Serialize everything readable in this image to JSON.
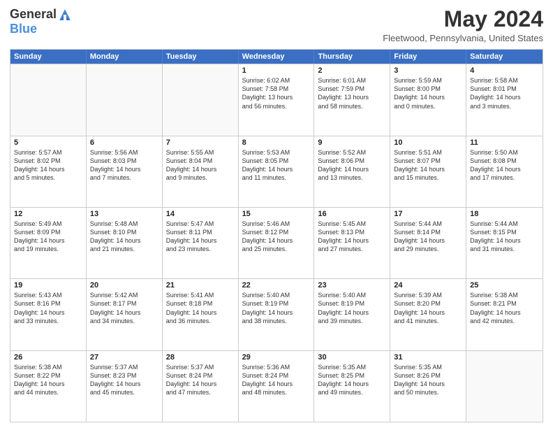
{
  "header": {
    "logo_general": "General",
    "logo_blue": "Blue",
    "month_title": "May 2024",
    "location": "Fleetwood, Pennsylvania, United States"
  },
  "calendar": {
    "days_of_week": [
      "Sunday",
      "Monday",
      "Tuesday",
      "Wednesday",
      "Thursday",
      "Friday",
      "Saturday"
    ],
    "rows": [
      [
        {
          "day": "",
          "empty": true
        },
        {
          "day": "",
          "empty": true
        },
        {
          "day": "",
          "empty": true
        },
        {
          "day": "1",
          "lines": [
            "Sunrise: 6:02 AM",
            "Sunset: 7:58 PM",
            "Daylight: 13 hours",
            "and 56 minutes."
          ]
        },
        {
          "day": "2",
          "lines": [
            "Sunrise: 6:01 AM",
            "Sunset: 7:59 PM",
            "Daylight: 13 hours",
            "and 58 minutes."
          ]
        },
        {
          "day": "3",
          "lines": [
            "Sunrise: 5:59 AM",
            "Sunset: 8:00 PM",
            "Daylight: 14 hours",
            "and 0 minutes."
          ]
        },
        {
          "day": "4",
          "lines": [
            "Sunrise: 5:58 AM",
            "Sunset: 8:01 PM",
            "Daylight: 14 hours",
            "and 3 minutes."
          ]
        }
      ],
      [
        {
          "day": "5",
          "lines": [
            "Sunrise: 5:57 AM",
            "Sunset: 8:02 PM",
            "Daylight: 14 hours",
            "and 5 minutes."
          ]
        },
        {
          "day": "6",
          "lines": [
            "Sunrise: 5:56 AM",
            "Sunset: 8:03 PM",
            "Daylight: 14 hours",
            "and 7 minutes."
          ]
        },
        {
          "day": "7",
          "lines": [
            "Sunrise: 5:55 AM",
            "Sunset: 8:04 PM",
            "Daylight: 14 hours",
            "and 9 minutes."
          ]
        },
        {
          "day": "8",
          "lines": [
            "Sunrise: 5:53 AM",
            "Sunset: 8:05 PM",
            "Daylight: 14 hours",
            "and 11 minutes."
          ]
        },
        {
          "day": "9",
          "lines": [
            "Sunrise: 5:52 AM",
            "Sunset: 8:06 PM",
            "Daylight: 14 hours",
            "and 13 minutes."
          ]
        },
        {
          "day": "10",
          "lines": [
            "Sunrise: 5:51 AM",
            "Sunset: 8:07 PM",
            "Daylight: 14 hours",
            "and 15 minutes."
          ]
        },
        {
          "day": "11",
          "lines": [
            "Sunrise: 5:50 AM",
            "Sunset: 8:08 PM",
            "Daylight: 14 hours",
            "and 17 minutes."
          ]
        }
      ],
      [
        {
          "day": "12",
          "lines": [
            "Sunrise: 5:49 AM",
            "Sunset: 8:09 PM",
            "Daylight: 14 hours",
            "and 19 minutes."
          ]
        },
        {
          "day": "13",
          "lines": [
            "Sunrise: 5:48 AM",
            "Sunset: 8:10 PM",
            "Daylight: 14 hours",
            "and 21 minutes."
          ]
        },
        {
          "day": "14",
          "lines": [
            "Sunrise: 5:47 AM",
            "Sunset: 8:11 PM",
            "Daylight: 14 hours",
            "and 23 minutes."
          ]
        },
        {
          "day": "15",
          "lines": [
            "Sunrise: 5:46 AM",
            "Sunset: 8:12 PM",
            "Daylight: 14 hours",
            "and 25 minutes."
          ]
        },
        {
          "day": "16",
          "lines": [
            "Sunrise: 5:45 AM",
            "Sunset: 8:13 PM",
            "Daylight: 14 hours",
            "and 27 minutes."
          ]
        },
        {
          "day": "17",
          "lines": [
            "Sunrise: 5:44 AM",
            "Sunset: 8:14 PM",
            "Daylight: 14 hours",
            "and 29 minutes."
          ]
        },
        {
          "day": "18",
          "lines": [
            "Sunrise: 5:44 AM",
            "Sunset: 8:15 PM",
            "Daylight: 14 hours",
            "and 31 minutes."
          ]
        }
      ],
      [
        {
          "day": "19",
          "lines": [
            "Sunrise: 5:43 AM",
            "Sunset: 8:16 PM",
            "Daylight: 14 hours",
            "and 33 minutes."
          ]
        },
        {
          "day": "20",
          "lines": [
            "Sunrise: 5:42 AM",
            "Sunset: 8:17 PM",
            "Daylight: 14 hours",
            "and 34 minutes."
          ]
        },
        {
          "day": "21",
          "lines": [
            "Sunrise: 5:41 AM",
            "Sunset: 8:18 PM",
            "Daylight: 14 hours",
            "and 36 minutes."
          ]
        },
        {
          "day": "22",
          "lines": [
            "Sunrise: 5:40 AM",
            "Sunset: 8:19 PM",
            "Daylight: 14 hours",
            "and 38 minutes."
          ]
        },
        {
          "day": "23",
          "lines": [
            "Sunrise: 5:40 AM",
            "Sunset: 8:19 PM",
            "Daylight: 14 hours",
            "and 39 minutes."
          ]
        },
        {
          "day": "24",
          "lines": [
            "Sunrise: 5:39 AM",
            "Sunset: 8:20 PM",
            "Daylight: 14 hours",
            "and 41 minutes."
          ]
        },
        {
          "day": "25",
          "lines": [
            "Sunrise: 5:38 AM",
            "Sunset: 8:21 PM",
            "Daylight: 14 hours",
            "and 42 minutes."
          ]
        }
      ],
      [
        {
          "day": "26",
          "lines": [
            "Sunrise: 5:38 AM",
            "Sunset: 8:22 PM",
            "Daylight: 14 hours",
            "and 44 minutes."
          ]
        },
        {
          "day": "27",
          "lines": [
            "Sunrise: 5:37 AM",
            "Sunset: 8:23 PM",
            "Daylight: 14 hours",
            "and 45 minutes."
          ]
        },
        {
          "day": "28",
          "lines": [
            "Sunrise: 5:37 AM",
            "Sunset: 8:24 PM",
            "Daylight: 14 hours",
            "and 47 minutes."
          ]
        },
        {
          "day": "29",
          "lines": [
            "Sunrise: 5:36 AM",
            "Sunset: 8:24 PM",
            "Daylight: 14 hours",
            "and 48 minutes."
          ]
        },
        {
          "day": "30",
          "lines": [
            "Sunrise: 5:35 AM",
            "Sunset: 8:25 PM",
            "Daylight: 14 hours",
            "and 49 minutes."
          ]
        },
        {
          "day": "31",
          "lines": [
            "Sunrise: 5:35 AM",
            "Sunset: 8:26 PM",
            "Daylight: 14 hours",
            "and 50 minutes."
          ]
        },
        {
          "day": "",
          "empty": true
        }
      ]
    ]
  }
}
